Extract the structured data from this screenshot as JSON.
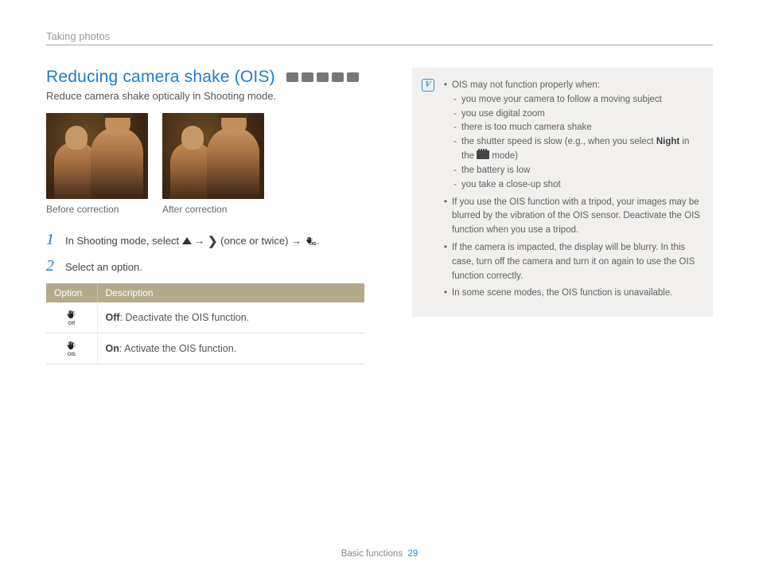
{
  "breadcrumb": "Taking photos",
  "heading": "Reducing camera shake (OIS)",
  "subheading": "Reduce camera shake optically in Shooting mode.",
  "photos": {
    "before_caption": "Before correction",
    "after_caption": "After correction"
  },
  "steps": {
    "s1": {
      "num": "1",
      "pre": "In Shooting mode, select ",
      "mid1": " → ",
      "paren": " (once or twice) → ",
      "end": "."
    },
    "s2": {
      "num": "2",
      "text": "Select an option."
    }
  },
  "table": {
    "h_option": "Option",
    "h_desc": "Description",
    "off_icon_sub": "Off",
    "off_bold": "Off",
    "off_desc": ": Deactivate the OIS function.",
    "on_icon_sub": "OIS",
    "on_bold": "On",
    "on_desc": ": Activate the OIS function."
  },
  "note": {
    "b1": "OIS may not function properly when:",
    "b1a": "you move your camera to follow a moving subject",
    "b1b": "you use digital zoom",
    "b1c": "there is too much camera shake",
    "b1d_pre": "the shutter speed is slow (e.g., when you select ",
    "b1d_bold": "Night",
    "b1d_mid": " in the ",
    "b1d_post": " mode)",
    "b1e": "the battery is low",
    "b1f": "you take a close-up shot",
    "b2": "If you use the OIS function with a tripod, your images may be blurred by the vibration of the OIS sensor. Deactivate the OIS function when you use a tripod.",
    "b3": "If the camera is impacted, the display will be blurry. In this case, turn off the camera and turn it on again to use the OIS function correctly.",
    "b4": "In some scene modes, the OIS function is unavailable."
  },
  "footer": {
    "section": "Basic functions",
    "page": "29"
  }
}
